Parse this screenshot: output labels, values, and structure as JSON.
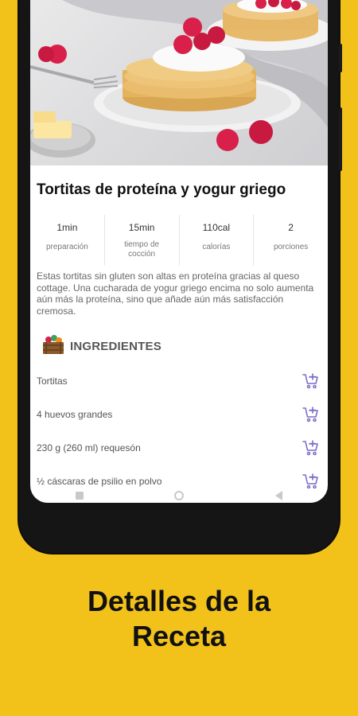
{
  "recipe": {
    "title": "Tortitas de proteína y yogur griego",
    "stats": [
      {
        "value": "1min",
        "label": "preparación"
      },
      {
        "value": "15min",
        "label": "tiempo de cocción"
      },
      {
        "value": "110cal",
        "label": "calorías"
      },
      {
        "value": "2",
        "label": "porciones"
      }
    ],
    "description": "Estas tortitas sin gluten son altas en proteína gracias al queso cottage. Una cucharada de yogur griego encima no solo aumenta aún más la proteína, sino que añade aún más satisfacción cremosa.",
    "ingredients_title": "INGREDIENTES",
    "ingredients": [
      "Tortitas",
      "4 huevos grandes",
      "230 g (260 ml) requesón",
      "½ cáscaras de psilio en polvo"
    ]
  },
  "caption": {
    "line1": "Detalles de la",
    "line2": "Receta"
  },
  "colors": {
    "background": "#F2C21B",
    "cart_icon": "#7a6fc7"
  },
  "icons": {
    "ingredients": "crate-of-vegetables-icon",
    "add_to_cart": "add-to-cart-icon"
  }
}
